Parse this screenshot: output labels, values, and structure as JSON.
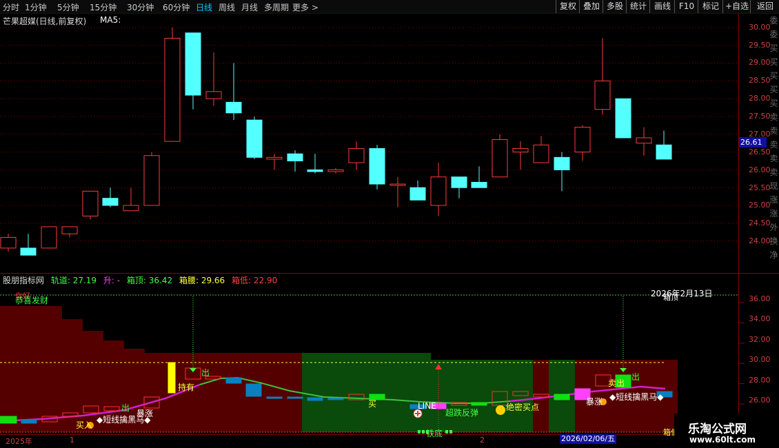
{
  "toolbar": {
    "timeframes": [
      "分时",
      "1分钟",
      "5分钟",
      "15分钟",
      "30分钟",
      "60分钟",
      "日线",
      "周线",
      "月线",
      "多周期",
      "更多 >"
    ],
    "active_timeframe": "日线",
    "right_buttons": [
      "复权",
      "叠加",
      "多股",
      "统计",
      "画线",
      "F10",
      "标记",
      "+自选",
      "返回"
    ]
  },
  "main_chart": {
    "title": "芒果超媒(日线,前复权)",
    "ma_label": "MA5:",
    "y_ticks": [
      "30.00",
      "29.50",
      "29.00",
      "28.50",
      "28.00",
      "27.50",
      "27.00",
      "26.50",
      "26.00",
      "25.50",
      "25.00",
      "24.50",
      "24.00"
    ],
    "current_price": "26.61",
    "side_chars": [
      "委",
      "委",
      "买",
      "买",
      "买",
      "买",
      "买",
      "卖",
      "卖",
      "卖",
      "卖",
      "卖",
      "现",
      "涨",
      "涨",
      "外",
      "换",
      "净"
    ]
  },
  "indicator": {
    "name": "股朋指标网",
    "track_label": "轨道: 27.19",
    "up_label": "升: -",
    "box_top_label": "箱顶: 36.42",
    "box_waist_label": "箱腰: 29.66",
    "box_bottom_label": "箱低: 22.90",
    "y_ticks": [
      "36.00",
      "34.00",
      "32.00",
      "30.00",
      "28.00",
      "26.00"
    ],
    "labels": {
      "gonxi": "恭喜发财",
      "gonxi_red": "你好",
      "date_note": "2026年2月13日",
      "box_top_right": "箱顶",
      "sell1": "出",
      "sell2": "出",
      "sell3": "出",
      "hold": "持有",
      "bao_zhang": "暴涨",
      "bao_zhang2": "暴涨",
      "dark_horse": "◆短线擒黑马◆",
      "dark_horse2": "◆短线擒黑马◆",
      "buy_mid": "买",
      "line": "LINE",
      "rebound": "超跌反弹",
      "secret_buy": "绝密买点",
      "iron_bottom": "铁底",
      "sell_right": "卖出",
      "buy_left": "买入",
      "box_low_right": "箱低"
    }
  },
  "x_axis": {
    "labels": [
      "2025年",
      "1",
      "2"
    ],
    "date_tag": "2026/02/06/五"
  },
  "watermark": {
    "line1": "乐淘公式网",
    "line2": "www.60lt.com"
  },
  "colors": {
    "up": "#ff3c3c",
    "down": "#54ffff",
    "grid": "#8b0000",
    "box_fill": "#550000",
    "green_zone": "#0a4a0a",
    "track": "#d020d0",
    "track_green": "#40c040",
    "yellow": "#ffff00"
  }
}
